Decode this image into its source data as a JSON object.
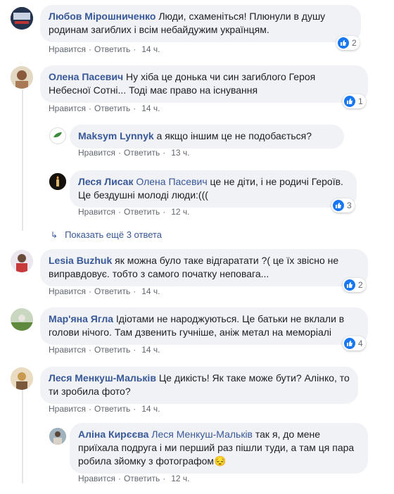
{
  "comments": [
    {
      "author": "Любов Мірошниченко",
      "text": "Люди, схаменіться! Плюнули в душу родинам загиблих і всім небайдужим українцям.",
      "like": "Нравится",
      "reply": "Ответить",
      "time": "14 ч.",
      "reactions": "2"
    },
    {
      "author": "Олена Пасевич",
      "text": "Ну хіба це донька чи син загиблого Героя Небесної Сотні... Тоді має право на існування",
      "like": "Нравится",
      "reply": "Ответить",
      "time": "14 ч.",
      "reactions": "1"
    },
    {
      "author": "Maksym Lynnyk",
      "text": "а якщо іншим це не подобається?",
      "like": "Нравится",
      "reply": "Ответить",
      "time": "13 ч."
    },
    {
      "author": "Леся Лисак",
      "mention": "Олена Пасевич",
      "text": " це не діти, і не родичі Героїв. Це бездушні молоді люди:(((",
      "like": "Нравится",
      "reply": "Ответить",
      "time": "12 ч.",
      "reactions": "3"
    },
    {
      "author": "Lesia Buzhuk",
      "text": "як можна було таке відгаратати ?( це їх звісно не виправдовує. тобто з самого початку неповага...",
      "like": "Нравится",
      "reply": "Ответить",
      "time": "14 ч.",
      "reactions": "2"
    },
    {
      "author": "Мар'яна Ягла",
      "text": "Ідіотами не народжуються. Це батьки не вклали в голови нічого. Там дзвенить гучніше, аніж метал на меморіалі",
      "like": "Нравится",
      "reply": "Ответить",
      "time": "14 ч.",
      "reactions": "4"
    },
    {
      "author": "Леся Менкуш-Мальків",
      "text": "Це дикість! Як таке може бути? Алінко, то ти зробила фото?",
      "like": "Нравится",
      "reply": "Ответить",
      "time": "14 ч."
    },
    {
      "author": "Аліна Кирєєва",
      "mention": "Леся Менкуш-Мальків",
      "text": " так я, до мене приїхала подруга і ми перший раз пішли туди, а там ця пара робила зйомку з фотографом😔",
      "like": "Нравится",
      "reply": "Ответить",
      "time": "12 ч."
    }
  ],
  "show_more": "Показать ещё 3 ответа",
  "colors": {
    "link": "#385898",
    "bubble": "#f0f2f5",
    "like": "#1877f2"
  }
}
